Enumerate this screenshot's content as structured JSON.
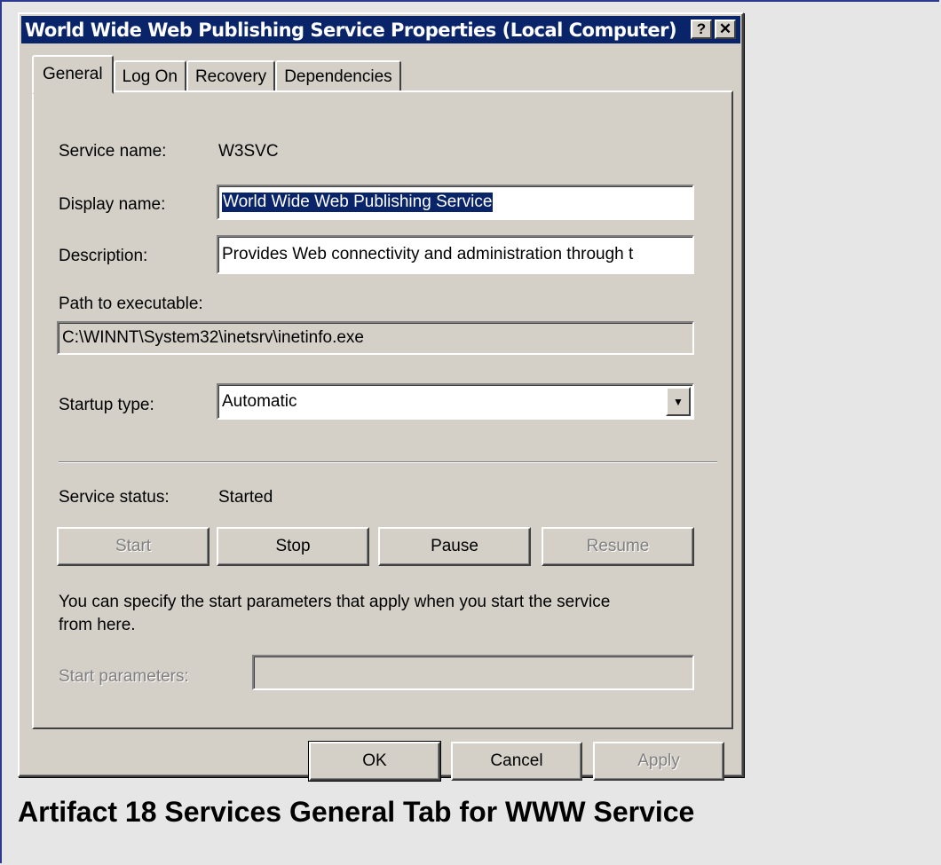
{
  "window": {
    "title": "World Wide Web Publishing Service Properties (Local Computer)",
    "help_glyph": "?",
    "close_glyph": "✕"
  },
  "tabs": [
    {
      "label": "General",
      "active": true
    },
    {
      "label": "Log On",
      "active": false
    },
    {
      "label": "Recovery",
      "active": false
    },
    {
      "label": "Dependencies",
      "active": false
    }
  ],
  "general": {
    "service_name_label": "Service name:",
    "service_name_value": "W3SVC",
    "display_name_label": "Display name:",
    "display_name_value": "World Wide Web Publishing Service",
    "description_label": "Description:",
    "description_value": "Provides Web connectivity and administration through t",
    "path_label": "Path to executable:",
    "path_value": "C:\\WINNT\\System32\\inetsrv\\inetinfo.exe",
    "startup_type_label": "Startup type:",
    "startup_type_value": "Automatic",
    "dropdown_arrow_glyph": "▼",
    "service_status_label": "Service status:",
    "service_status_value": "Started",
    "buttons": {
      "start": "Start",
      "stop": "Stop",
      "pause": "Pause",
      "resume": "Resume"
    },
    "info_text_line1": "You can specify the start parameters that apply when you start the service",
    "info_text_line2": "from here.",
    "start_params_label": "Start parameters:",
    "start_params_value": ""
  },
  "footer": {
    "ok": "OK",
    "cancel": "Cancel",
    "apply": "Apply"
  },
  "caption": "Artifact 18 Services General Tab for WWW Service",
  "colors": {
    "titlebar": "#0a246a",
    "dialog_face": "#d4d0c8",
    "page_background": "#e6e6e6",
    "selection": "#0a246a"
  }
}
